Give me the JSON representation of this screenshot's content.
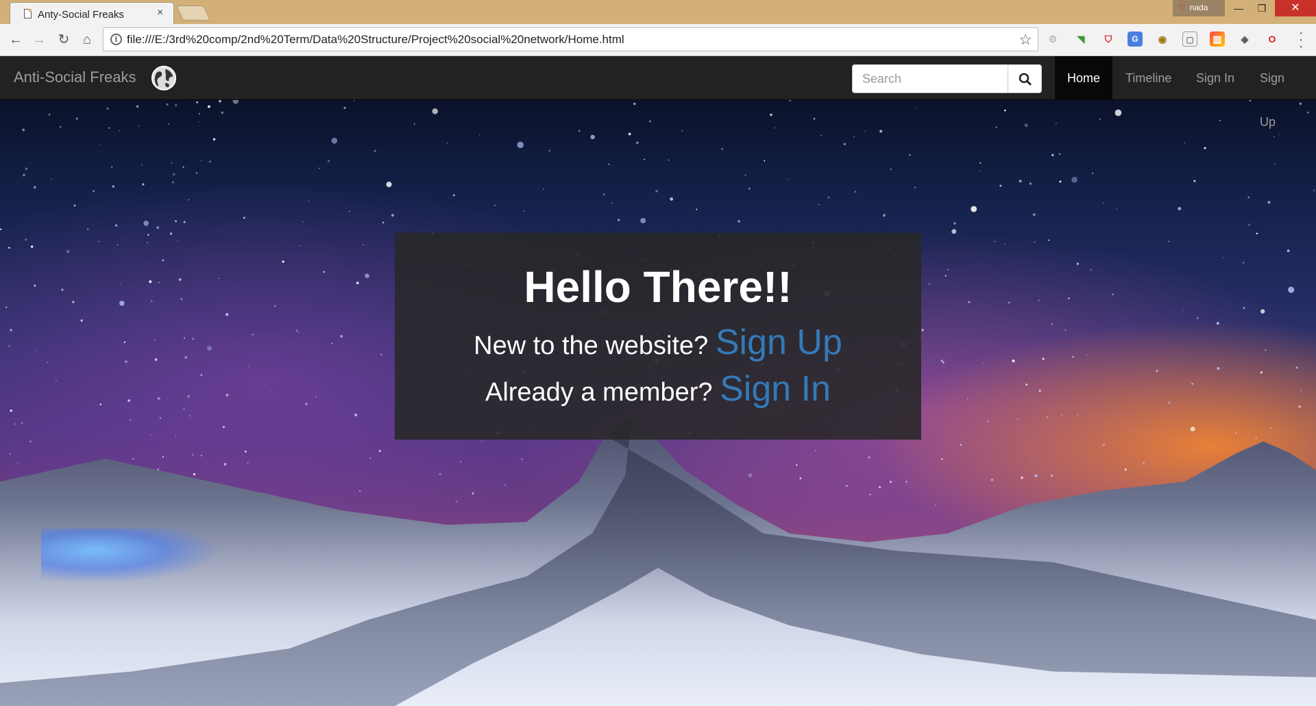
{
  "browser": {
    "tab_title": "Anty-Social Freaks",
    "tab_close": "×",
    "profile_name": "nada",
    "url": "file:///E:/3rd%20comp/2nd%20Term/Data%20Structure/Project%20social%20network/Home.html",
    "icons": [
      "back-icon",
      "forward-icon",
      "reload-icon",
      "home-icon",
      "info-icon",
      "star-icon",
      "menu-icon"
    ],
    "window_controls": {
      "minimize": "—",
      "maximize": "❐",
      "close": "✕"
    }
  },
  "navbar": {
    "brand": "Anti-Social Freaks",
    "search_placeholder": "Search",
    "links": [
      "Home",
      "Timeline",
      "Sign In",
      "Sign Up"
    ],
    "active_link": "Home"
  },
  "hero": {
    "title": "Hello There!!",
    "line1_text": "New to the website?",
    "line1_link": "Sign Up",
    "line2_text": "Already a member?",
    "line2_link": "Sign In"
  },
  "colors": {
    "navbar_bg": "#222222",
    "link_blue": "#337ab7",
    "titlebar": "#d3b078"
  }
}
